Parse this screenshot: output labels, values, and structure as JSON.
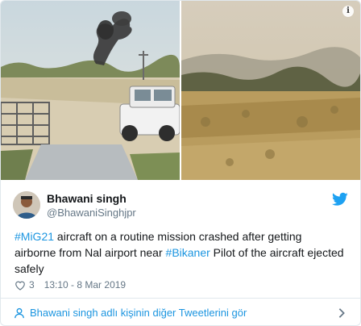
{
  "author": {
    "display_name": "Bhawani singh",
    "handle": "@BhawaniSinghjpr"
  },
  "tweet": {
    "segments": [
      {
        "text": "#MiG21",
        "type": "hashtag"
      },
      {
        "text": " aircraft on a routine mission crashed after getting airborne from Nal airport near ",
        "type": "text"
      },
      {
        "text": "#Bikaner",
        "type": "hashtag"
      },
      {
        "text": " Pilot of the aircraft ejected safely",
        "type": "text"
      }
    ]
  },
  "meta": {
    "likes": "3",
    "timestamp": "13:10 - 8 Mar 2019"
  },
  "footer": {
    "more_tweets_label": "Bhawani singh adlı kişinin diğer Tweetlerini gör"
  },
  "media": {
    "info_badge": "i"
  },
  "icons": {
    "heart": "heart-icon",
    "twitter": "twitter-bird-icon",
    "person": "person-icon",
    "chevron": "chevron-right-icon"
  },
  "colors": {
    "link": "#1b95e0",
    "secondary_text": "#657786",
    "border": "#e1e8ed"
  }
}
